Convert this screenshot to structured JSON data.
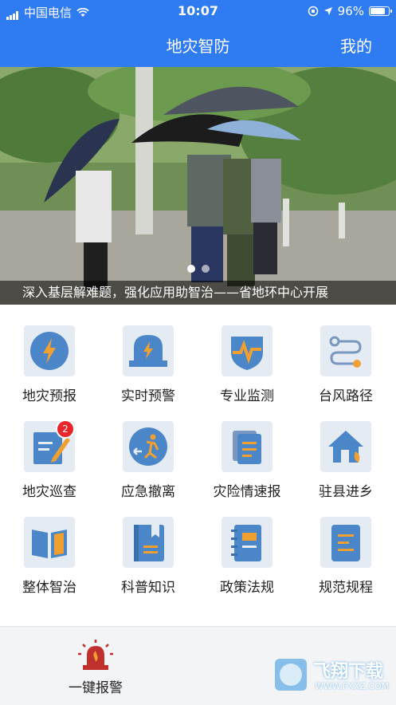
{
  "status_bar": {
    "carrier": "中国电信",
    "time": "10:07",
    "battery": "96%",
    "battery_level": 0.96
  },
  "nav": {
    "title": "地灾智防",
    "right_label": "我的"
  },
  "banner": {
    "caption": "深入基层解难题，强化应用助智治——省地环中心开展",
    "page_count": 2,
    "active_page": 1
  },
  "grid": {
    "items": [
      {
        "label": "地灾预报",
        "icon": "lightning-icon"
      },
      {
        "label": "实时预警",
        "icon": "alarm-icon"
      },
      {
        "label": "专业监测",
        "icon": "shield-monitor-icon"
      },
      {
        "label": "台风路径",
        "icon": "route-icon"
      },
      {
        "label": "地灾巡查",
        "icon": "edit-note-icon",
        "badge": "2"
      },
      {
        "label": "应急撤离",
        "icon": "evacuation-icon"
      },
      {
        "label": "灾险情速报",
        "icon": "clipboard-icon"
      },
      {
        "label": "驻县进乡",
        "icon": "house-icon"
      },
      {
        "label": "整体智治",
        "icon": "book-open-icon"
      },
      {
        "label": "科普知识",
        "icon": "book-bookmark-icon"
      },
      {
        "label": "政策法规",
        "icon": "notebook-icon"
      },
      {
        "label": "规范规程",
        "icon": "document-icon"
      }
    ]
  },
  "bottom": {
    "alarm_label": "一键报警",
    "watermark_text": "飞翔下载",
    "watermark_url": "WWW.FXXZ.COM"
  },
  "colors": {
    "primary": "#2f7bf2",
    "icon_blue": "#4a86c8",
    "icon_orange": "#f0a030",
    "badge_red": "#e8262b"
  }
}
